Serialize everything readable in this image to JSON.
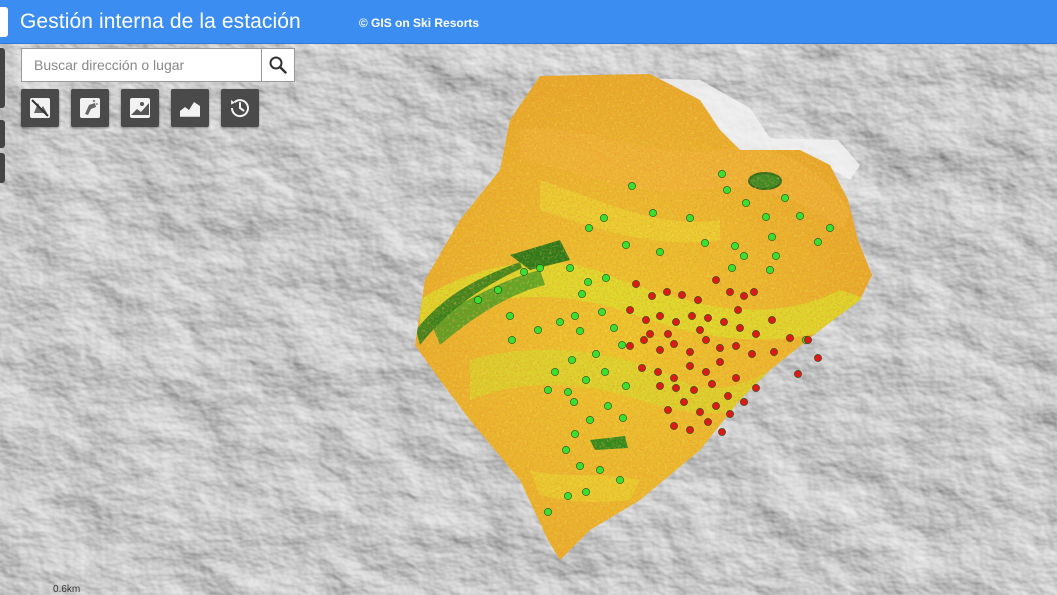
{
  "header": {
    "title": "Gestión interna de la estación",
    "copyright": "© GIS on Ski Resorts",
    "color": "#3b8df2"
  },
  "search": {
    "placeholder": "Buscar dirección o lugar",
    "button_icon": "search-icon"
  },
  "toolbar": {
    "tools": [
      {
        "icon": "no-snow-icon"
      },
      {
        "icon": "snow-cannon-icon"
      },
      {
        "icon": "slope-icon"
      },
      {
        "icon": "area-chart-icon"
      },
      {
        "icon": "history-clock-icon"
      }
    ]
  },
  "map": {
    "scale_label": "0.6km",
    "legend_colors": {
      "low": "#2e9e1f",
      "mid": "#e9e31c",
      "high": "#e9a21c",
      "very_high": "#e24b1f",
      "point_ok": "#39e02f",
      "point_alert": "#e01818"
    }
  }
}
